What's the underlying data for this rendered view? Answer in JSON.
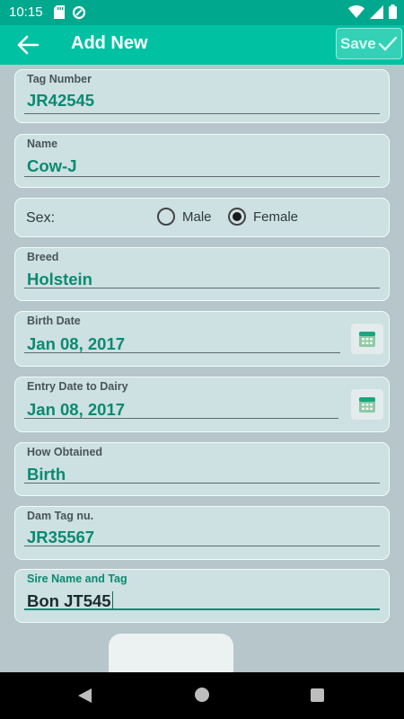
{
  "status_bar": {
    "time": "10:15"
  },
  "app_bar": {
    "title": "Add New",
    "save_label": "Save"
  },
  "form": {
    "tag_number": {
      "label": "Tag Number",
      "value": "JR42545"
    },
    "name": {
      "label": "Name",
      "value": "Cow-J"
    },
    "sex": {
      "label": "Sex:",
      "options": [
        "Male",
        "Female"
      ],
      "selected": "Female"
    },
    "breed": {
      "label": "Breed",
      "value": "Holstein"
    },
    "birth_date": {
      "label": "Birth Date",
      "value": "Jan 08, 2017"
    },
    "entry_date": {
      "label": "Entry Date to Dairy",
      "value": "Jan 08, 2017"
    },
    "how_obtained": {
      "label": "How Obtained",
      "value": "Birth"
    },
    "dam_tag": {
      "label": "Dam Tag nu.",
      "value": "JR35567"
    },
    "sire": {
      "label": "Sire Name and Tag",
      "value": "Bon JT545"
    }
  },
  "icons": {
    "back": "arrow-left-icon",
    "save": "checkmark-icon",
    "calendar": "calendar-icon",
    "wifi": "wifi-icon",
    "signal": "signal-icon",
    "battery": "battery-icon"
  },
  "colors": {
    "status_bar": "#00a88e",
    "app_bar": "#00c2a3",
    "accent_text": "#0a8a72",
    "background": "#b6c6cb",
    "card": "#cde0e2"
  }
}
